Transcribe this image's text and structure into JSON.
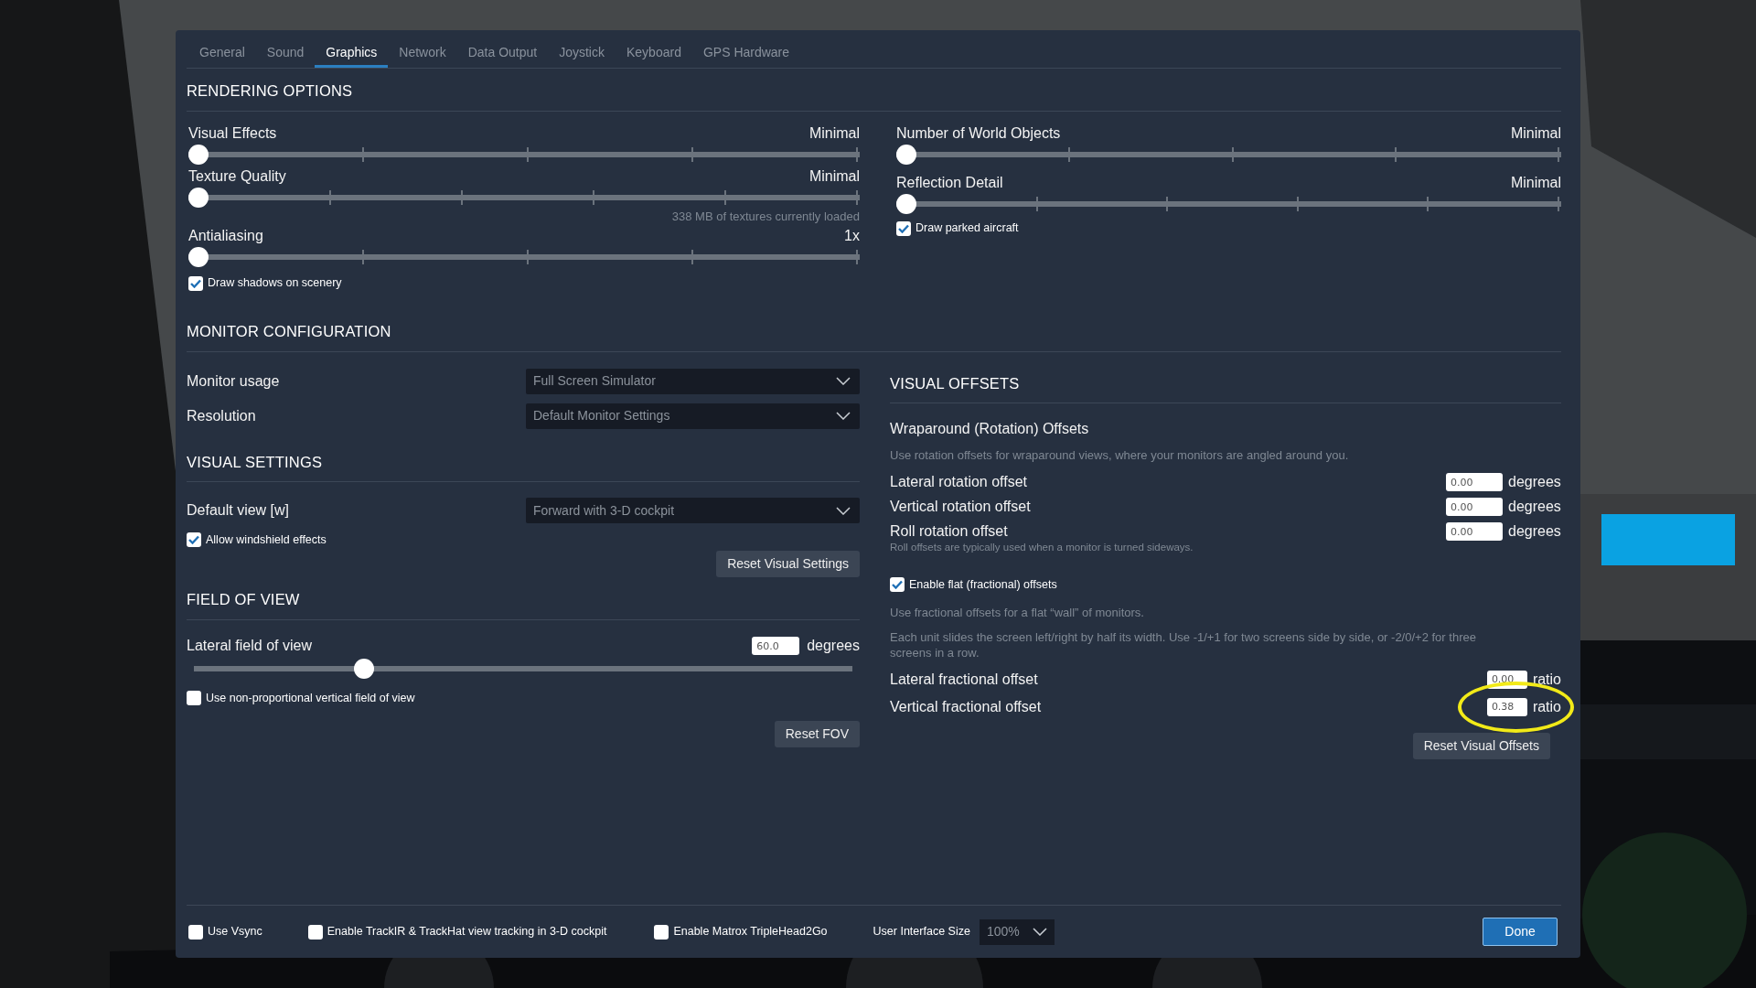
{
  "tabs": [
    {
      "label": "General",
      "selected": false
    },
    {
      "label": "Sound",
      "selected": false
    },
    {
      "label": "Graphics",
      "selected": true
    },
    {
      "label": "Network",
      "selected": false
    },
    {
      "label": "Data Output",
      "selected": false
    },
    {
      "label": "Joystick",
      "selected": false
    },
    {
      "label": "Keyboard",
      "selected": false
    },
    {
      "label": "GPS Hardware",
      "selected": false
    }
  ],
  "rendering": {
    "title": "RENDERING OPTIONS",
    "left_sliders": [
      {
        "label": "Visual Effects",
        "reading": "Minimal",
        "level": 0
      },
      {
        "label": "Texture Quality",
        "reading": "Minimal",
        "level": 0,
        "note": "338 MB of textures currently loaded"
      },
      {
        "label": "Antialiasing",
        "reading": "1x",
        "level": 0
      }
    ],
    "left_checkbox": {
      "label": "Draw shadows on scenery",
      "checked": true
    },
    "right_sliders": [
      {
        "label": "Number of World Objects",
        "reading": "Minimal",
        "level": 0
      },
      {
        "label": "Reflection Detail",
        "reading": "Minimal",
        "level": 0
      }
    ],
    "right_checkbox": {
      "label": "Draw parked aircraft",
      "checked": true
    }
  },
  "monitor": {
    "title": "MONITOR CONFIGURATION",
    "rows": [
      {
        "label": "Monitor usage",
        "value": "Full Screen Simulator"
      },
      {
        "label": "Resolution",
        "value": "Default Monitor Settings"
      }
    ]
  },
  "visual_settings": {
    "title": "VISUAL SETTINGS",
    "rows": [
      {
        "label": "Default view [w]",
        "value": "Forward with 3-D cockpit"
      }
    ],
    "checkbox": {
      "label": "Allow windshield effects",
      "checked": true
    },
    "button": "Reset Visual Settings"
  },
  "field_of_view": {
    "title": "FIELD OF VIEW",
    "label": "Lateral field of view",
    "value": "60.0",
    "unit": "degrees",
    "level": 0.25,
    "checkbox": {
      "label": "Use non-proportional vertical field of view",
      "checked": false
    },
    "button": "Reset FOV"
  },
  "visual_offsets": {
    "title": "VISUAL OFFSETS",
    "subtitle": "Wraparound (Rotation) Offsets",
    "description": "Use rotation offsets for wraparound views, where your monitors are angled around you.",
    "rotation_rows": [
      {
        "label": "Lateral rotation offset",
        "value": "0.00",
        "unit": "degrees"
      },
      {
        "label": "Vertical rotation offset",
        "value": "0.00",
        "unit": "degrees"
      },
      {
        "label": "Roll rotation offset",
        "value": "0.00",
        "unit": "degrees"
      }
    ],
    "roll_note": "Roll offsets are typically used when a monitor is turned sideways.",
    "flat_checkbox": {
      "label": "Enable flat (fractional) offsets",
      "checked": true
    },
    "flat_notes": [
      "Use fractional offsets for a flat “wall” of monitors.",
      "Each unit slides the screen left/right by half its width. Use -1/+1 for two screens side by side, or -2/0/+2 for three screens in a row."
    ],
    "fractional_rows": [
      {
        "label": "Lateral fractional offset",
        "value": "0.00",
        "unit": "ratio",
        "highlighted": false
      },
      {
        "label": "Vertical fractional offset",
        "value": "0.38",
        "unit": "ratio",
        "highlighted": true
      }
    ],
    "button": "Reset Visual Offsets"
  },
  "footer": {
    "checkboxes": [
      {
        "label": "Use Vsync",
        "checked": false
      },
      {
        "label": "Enable TrackIR & TrackHat view tracking in 3-D cockpit",
        "checked": false
      },
      {
        "label": "Enable Matrox TripleHead2Go",
        "checked": false
      }
    ],
    "ui_size_label": "User Interface Size",
    "ui_size_value": "100%",
    "done": "Done"
  }
}
